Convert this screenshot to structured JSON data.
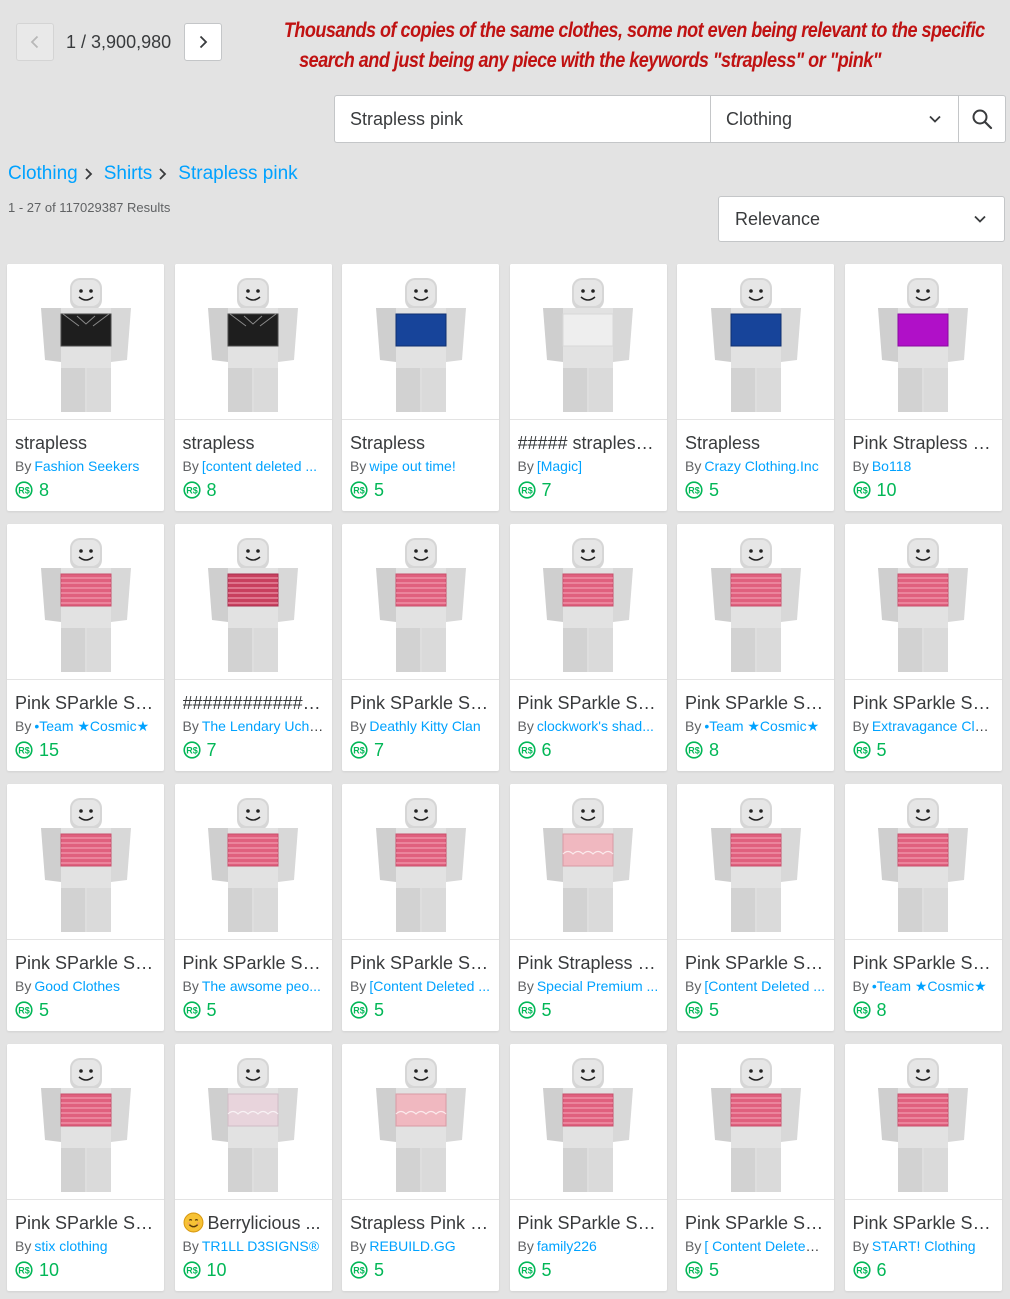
{
  "pagination": {
    "current": "1",
    "separator": "/",
    "total": "3,900,980"
  },
  "annotation": {
    "line1": "Thousands of copies of the same clothes, some not even being relevant to the specific",
    "line2": "search and just being any piece with the keywords \"strapless\" or \"pink\""
  },
  "search": {
    "query": "Strapless pink",
    "category": "Clothing"
  },
  "breadcrumb": [
    "Clothing",
    "Shirts",
    "Strapless pink"
  ],
  "results_count": "1 - 27 of 117029387 Results",
  "sort": {
    "selected": "Relevance"
  },
  "by_label": "By",
  "colors": {
    "link": "#00a2ff",
    "price": "#02b757",
    "annotation": "#c01212",
    "background": "#e3e3e3"
  },
  "items": [
    {
      "name": "strapless",
      "creator": "Fashion Seekers",
      "price": "8",
      "top": "black-lace"
    },
    {
      "name": "strapless",
      "creator": "[content deleted ...",
      "price": "8",
      "top": "black-lace"
    },
    {
      "name": "Strapless",
      "creator": "wipe out time!",
      "price": "5",
      "top": "blue"
    },
    {
      "name": "##### strapless ...",
      "creator": "[Magic]",
      "price": "7",
      "top": "white"
    },
    {
      "name": "Strapless",
      "creator": "Crazy Clothing.Inc",
      "price": "5",
      "top": "blue"
    },
    {
      "name": "Pink Strapless S...",
      "creator": "Bo118",
      "price": "10",
      "top": "magenta"
    },
    {
      "name": "Pink SParkle Str...",
      "creator": "•Team ★Cosmic★",
      "price": "15",
      "top": "pink-striped"
    },
    {
      "name": "##############...",
      "creator": "The Lendary Uchi...",
      "price": "7",
      "top": "pink-dark"
    },
    {
      "name": "Pink SParkle Str...",
      "creator": "Deathly Kitty Clan",
      "price": "7",
      "top": "pink-striped"
    },
    {
      "name": "Pink SParkle Str...",
      "creator": "clockwork's shad...",
      "price": "6",
      "top": "pink-striped"
    },
    {
      "name": "Pink SParkle Str...",
      "creator": "•Team ★Cosmic★",
      "price": "8",
      "top": "pink-striped"
    },
    {
      "name": "Pink SParkle Str...",
      "creator": "Extravagance Clot...",
      "price": "5",
      "top": "pink-striped"
    },
    {
      "name": "Pink SParkle Str...",
      "creator": "Good Clothes",
      "price": "5",
      "top": "pink-striped"
    },
    {
      "name": "Pink SParkle Str...",
      "creator": "The awsome peo...",
      "price": "5",
      "top": "pink-striped"
    },
    {
      "name": "Pink SParkle Str...",
      "creator": "[Content Deleted ...",
      "price": "5",
      "top": "pink-striped"
    },
    {
      "name": "Pink Strapless R...",
      "creator": "Special Premium ...",
      "price": "5",
      "top": "pink-ruffle"
    },
    {
      "name": "Pink SParkle Str...",
      "creator": "[Content Deleted ...",
      "price": "5",
      "top": "pink-striped"
    },
    {
      "name": "Pink SParkle Str...",
      "creator": "•Team ★Cosmic★",
      "price": "8",
      "top": "pink-striped"
    },
    {
      "name": "Pink SParkle Str...",
      "creator": "stix clothing",
      "price": "10",
      "top": "pink-striped"
    },
    {
      "name": "Berrylicious ...",
      "creator": "TR1LL D3SIGNS®",
      "price": "10",
      "top": "pale-pink",
      "emoji": "smiling-face-emoji"
    },
    {
      "name": "Strapless Pink R...",
      "creator": "REBUILD.GG",
      "price": "5",
      "top": "pink-ruffle"
    },
    {
      "name": "Pink SParkle Str...",
      "creator": "family226",
      "price": "5",
      "top": "pink-striped"
    },
    {
      "name": "Pink SParkle Str...",
      "creator": "[ Content Deleted ...",
      "price": "5",
      "top": "pink-striped"
    },
    {
      "name": "Pink SParkle Str...",
      "creator": "START! Clothing",
      "price": "6",
      "top": "pink-striped"
    }
  ]
}
